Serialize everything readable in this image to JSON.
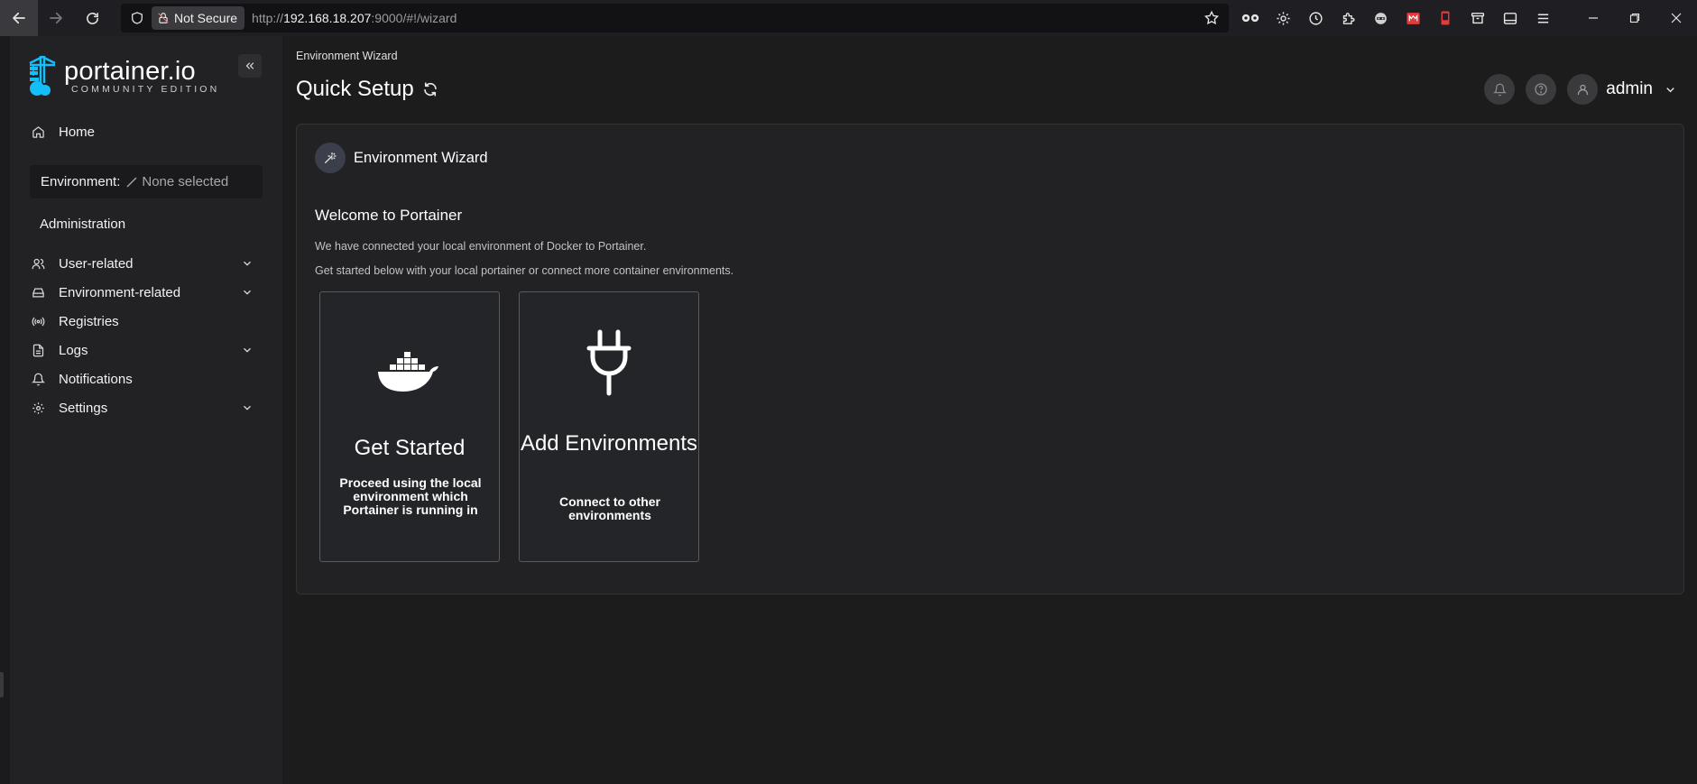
{
  "browser": {
    "not_secure_label": "Not Secure",
    "url_scheme": "http://",
    "url_host": "192.168.18.207",
    "url_rest": ":9000/#!/wizard"
  },
  "sidebar": {
    "logo_name": "portainer.io",
    "logo_sub": "COMMUNITY EDITION",
    "home_label": "Home",
    "environment_label": "Environment:",
    "environment_value": "None selected",
    "section_title": "Administration",
    "items": [
      {
        "label": "User-related",
        "icon": "users-icon",
        "expandable": true
      },
      {
        "label": "Environment-related",
        "icon": "drive-icon",
        "expandable": true
      },
      {
        "label": "Registries",
        "icon": "broadcast-icon",
        "expandable": false
      },
      {
        "label": "Logs",
        "icon": "file-text-icon",
        "expandable": true
      },
      {
        "label": "Notifications",
        "icon": "bell-icon",
        "expandable": false
      },
      {
        "label": "Settings",
        "icon": "gear-icon",
        "expandable": true
      }
    ]
  },
  "header": {
    "breadcrumb": "Environment Wizard",
    "title": "Quick Setup",
    "user_name": "admin"
  },
  "wizard": {
    "title": "Environment Wizard",
    "welcome": "Welcome to Portainer",
    "desc_1": "We have connected your local environment of Docker to Portainer.",
    "desc_2": "Get started below with your local portainer or connect more container environments.",
    "cards": [
      {
        "title": "Get Started",
        "description": "Proceed using the local environment which Portainer is running in",
        "icon": "docker-whale-icon"
      },
      {
        "title": "Add Environments",
        "description": "Connect to other environments",
        "icon": "plug-icon"
      }
    ]
  },
  "colors": {
    "sidebar_bg": "#222224",
    "main_bg": "#1c1c1c",
    "accent": "#13bef9"
  }
}
